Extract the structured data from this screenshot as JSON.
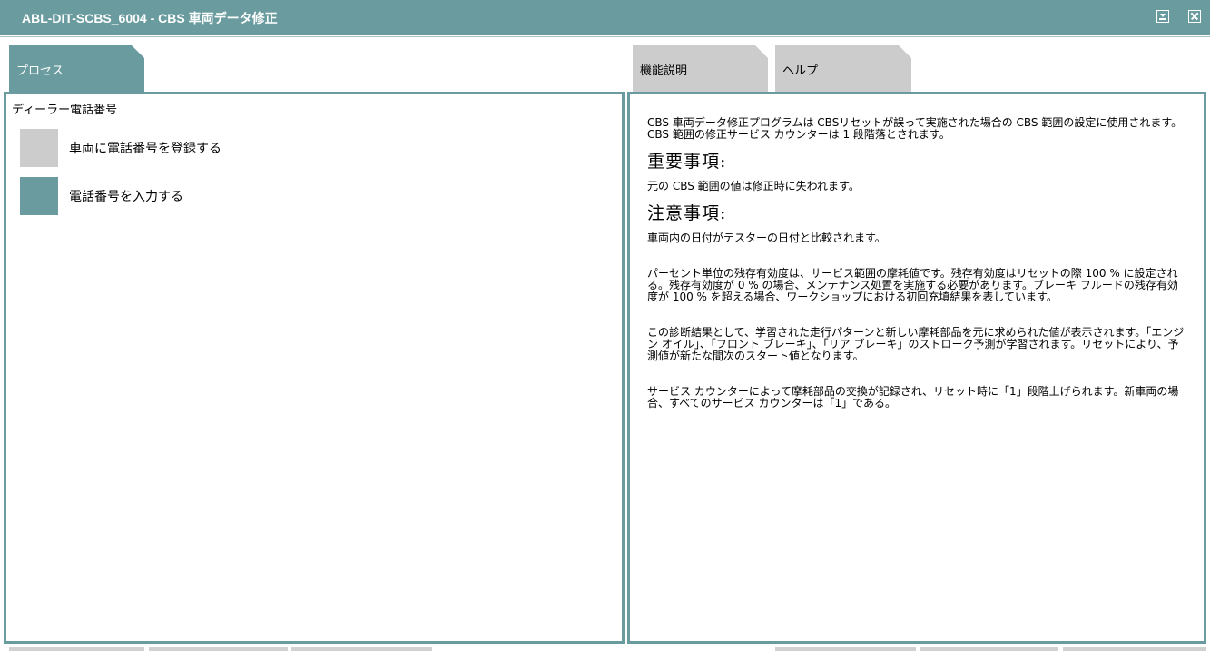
{
  "window": {
    "title": "ABL-DIT-SCBS_6004  -  CBS 車両データ修正"
  },
  "tabs": {
    "process": "プロセス",
    "function_description": "機能説明",
    "help": "ヘルプ"
  },
  "process": {
    "section_title": "ディーラー電話番号",
    "steps": [
      {
        "label": "車両に電話番号を登録する",
        "state": "inactive"
      },
      {
        "label": "電話番号を入力する",
        "state": "active"
      }
    ]
  },
  "help": {
    "intro": [
      "CBS 車両データ修正プログラムは CBSリセットが誤って実施された場合の CBS 範囲の設定に使用されます。",
      "CBS 範囲の修正サービス カウンターは 1 段階落とされます。"
    ],
    "important_heading": "重要事項:",
    "important_text": "元の CBS 範囲の値は修正時に失われます。",
    "notes_heading": "注意事項:",
    "notes": [
      "車両内の日付がテスターの日付と比較されます。",
      "パーセント単位の残存有効度は、サービス範囲の摩耗値です。残存有効度はリセットの際 100 % に設定される。残存有効度が 0 % の場合、メンテナンス処置を実施する必要があります。ブレーキ フルードの残存有効度が 100 % を超える場合、ワークショップにおける初回充填結果を表しています。",
      "この診断結果として、学習された走行パターンと新しい摩耗部品を元に求められた値が表示されます。「エンジン オイル」、「フロント ブレーキ」、「リア ブレーキ」のストローク予測が学習されます。リセットにより、予測値が新たな間次のスタート値となります。",
      "サービス カウンターによって摩耗部品の交換が記録され、リセット時に「1」段階上げられます。新車両の場合、すべてのサービス カウンターは「1」である。"
    ]
  },
  "colors": {
    "accent": "#6a9c9f",
    "inactive": "#cccccc"
  },
  "icons": {
    "minimize": "minimize-icon",
    "close": "close-icon"
  }
}
